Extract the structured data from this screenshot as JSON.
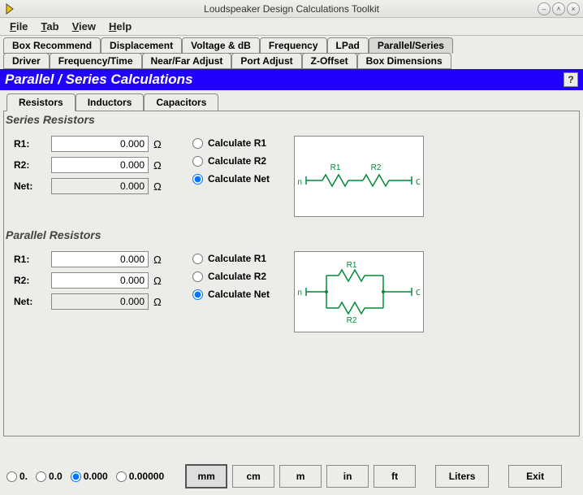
{
  "window": {
    "title": "Loudspeaker Design Calculations Toolkit"
  },
  "menu": {
    "file": "File",
    "tab": "Tab",
    "view": "View",
    "help": "Help"
  },
  "tabs_row1": [
    "Box Recommend",
    "Displacement",
    "Voltage & dB",
    "Frequency",
    "LPad",
    "Parallel/Series"
  ],
  "tabs_row1_active": 5,
  "tabs_row2": [
    "Driver",
    "Frequency/Time",
    "Near/Far Adjust",
    "Port Adjust",
    "Z-Offset",
    "Box Dimensions"
  ],
  "panel_title": "Parallel / Series Calculations",
  "help_label": "?",
  "subtabs": [
    "Resistors",
    "Inductors",
    "Capacitors"
  ],
  "subtabs_active": 0,
  "series": {
    "header": "Series Resistors",
    "r1_label": "R1:",
    "r1_value": "0.000",
    "r2_label": "R2:",
    "r2_value": "0.000",
    "net_label": "Net:",
    "net_value": "0.000",
    "unit": "Ω",
    "opt_r1": "Calculate R1",
    "opt_r2": "Calculate R2",
    "opt_net": "Calculate Net",
    "selected": "net",
    "diag": {
      "in": "In",
      "out": "Out",
      "r1": "R1",
      "r2": "R2"
    }
  },
  "parallel": {
    "header": "Parallel Resistors",
    "r1_label": "R1:",
    "r1_value": "0.000",
    "r2_label": "R2:",
    "r2_value": "0.000",
    "net_label": "Net:",
    "net_value": "0.000",
    "unit": "Ω",
    "opt_r1": "Calculate R1",
    "opt_r2": "Calculate R2",
    "opt_net": "Calculate Net",
    "selected": "net",
    "diag": {
      "in": "In",
      "out": "Out",
      "r1": "R1",
      "r2": "R2"
    }
  },
  "precision": {
    "opts": [
      "0.",
      "0.0",
      "0.000",
      "0.00000"
    ],
    "selected": 2
  },
  "units": {
    "opts": [
      "mm",
      "cm",
      "m",
      "in",
      "ft"
    ],
    "selected": 0,
    "liters": "Liters",
    "exit": "Exit"
  }
}
